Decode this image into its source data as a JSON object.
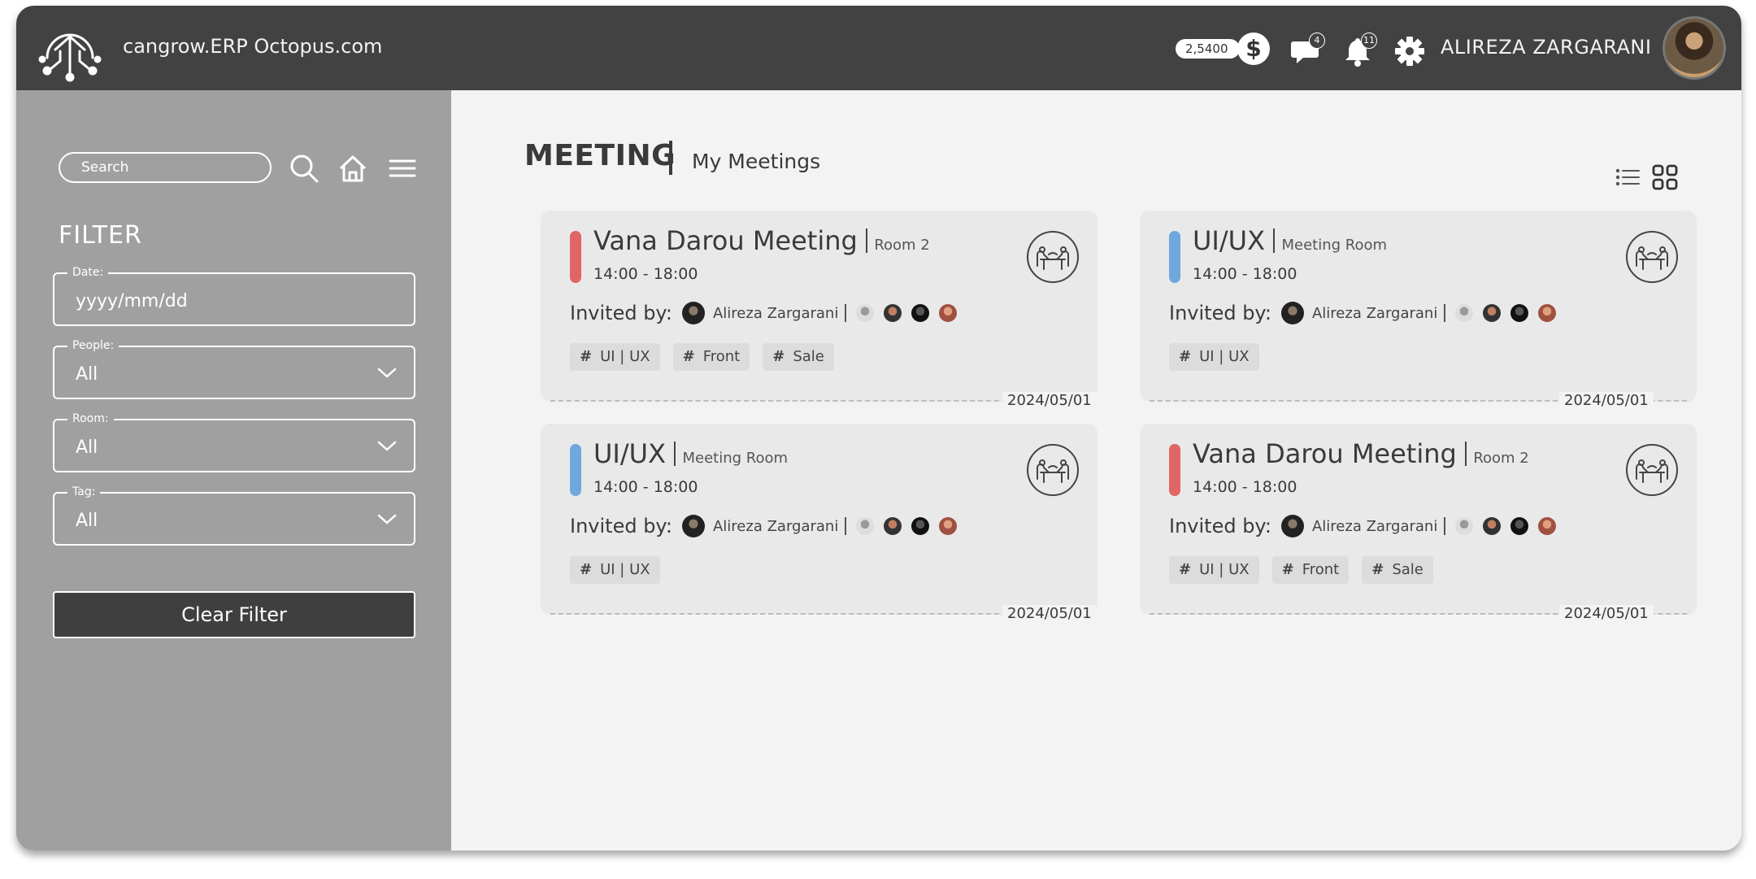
{
  "header": {
    "brand": "cangrow.ERP Octopus.com",
    "coins": "2,5400",
    "coin_symbol": "$",
    "messages_count": "4",
    "notifications_count": "11",
    "user_name": "ALIREZA ZARGARANI"
  },
  "sidebar": {
    "search_placeholder": "Search",
    "filter_title": "FILTER",
    "fields": {
      "date": {
        "label": "Date:",
        "placeholder": "yyyy/mm/dd"
      },
      "people": {
        "label": "People:",
        "value": "All"
      },
      "room": {
        "label": "Room:",
        "value": "All"
      },
      "tag": {
        "label": "Tag:",
        "value": "All"
      }
    },
    "clear_label": "Clear Filter"
  },
  "main": {
    "title": "MEETING",
    "subtitle": "My Meetings",
    "cards": [
      {
        "title": "Vana Darou Meeting",
        "room": "Room 2",
        "time": "14:00 - 18:00",
        "invited_label": "Invited by:",
        "invited_name": "Alireza Zargarani",
        "tags": [
          "UI | UX",
          "Front",
          "Sale"
        ],
        "date": "2024/05/01",
        "color": "#e06666"
      },
      {
        "title": "UI/UX",
        "room": "Meeting Room",
        "time": "14:00 - 18:00",
        "invited_label": "Invited by:",
        "invited_name": "Alireza Zargarani",
        "tags": [
          "UI | UX"
        ],
        "date": "2024/05/01",
        "color": "#6fa8dc"
      },
      {
        "title": "UI/UX",
        "room": "Meeting Room",
        "time": "14:00 - 18:00",
        "invited_label": "Invited by:",
        "invited_name": "Alireza Zargarani",
        "tags": [
          "UI | UX"
        ],
        "date": "2024/05/01",
        "color": "#6fa8dc"
      },
      {
        "title": "Vana Darou Meeting",
        "room": "Room 2",
        "time": "14:00 - 18:00",
        "invited_label": "Invited by:",
        "invited_name": "Alireza Zargarani",
        "tags": [
          "UI | UX",
          "Front",
          "Sale"
        ],
        "date": "2024/05/01",
        "color": "#e06666"
      }
    ]
  }
}
